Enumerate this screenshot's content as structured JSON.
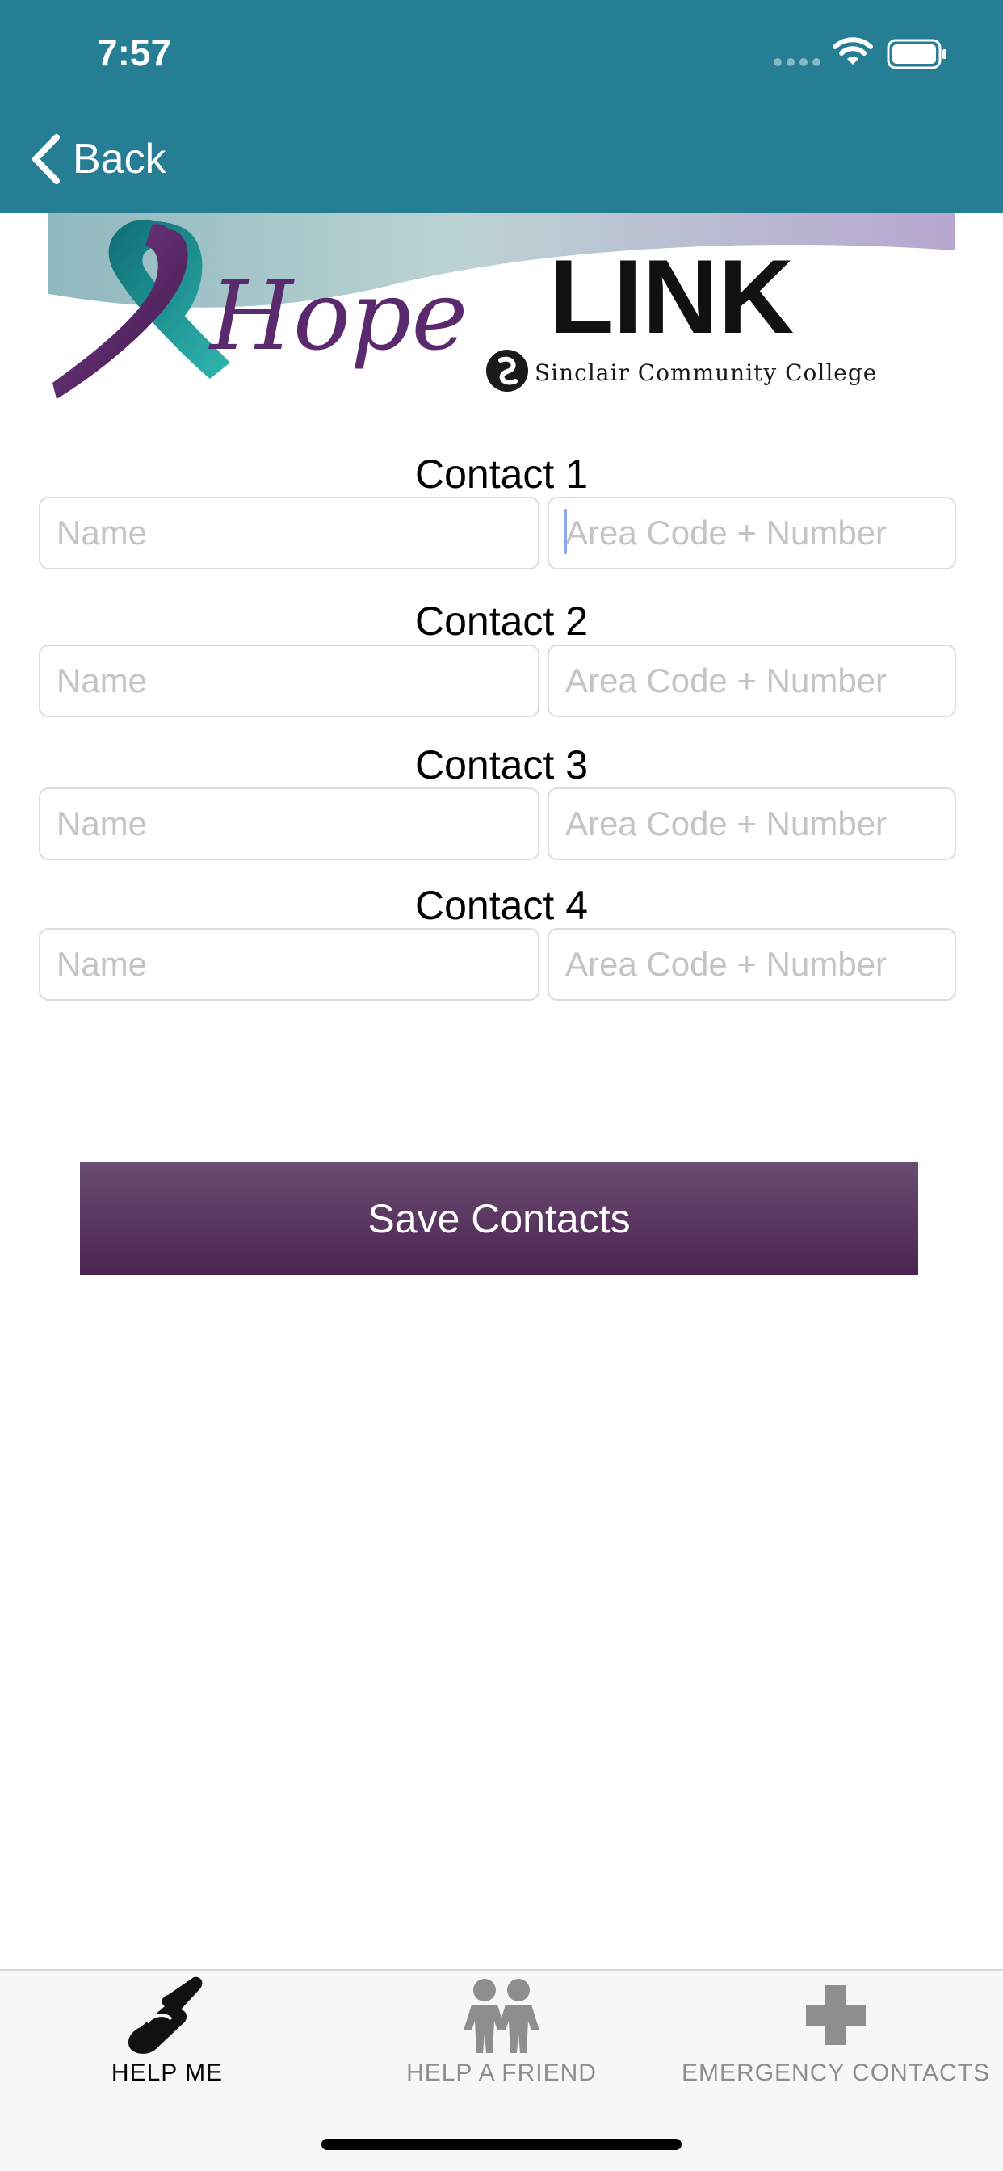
{
  "status_bar": {
    "time": "7:57"
  },
  "navigation": {
    "back_label": "Back"
  },
  "banner": {
    "logo_hope": "Hope",
    "logo_link": "LINK",
    "logo_college": "Sinclair Community College"
  },
  "contacts": [
    {
      "title": "Contact 1",
      "name_placeholder": "Name",
      "phone_placeholder": "Area Code + Number",
      "name_value": "",
      "phone_value": ""
    },
    {
      "title": "Contact 2",
      "name_placeholder": "Name",
      "phone_placeholder": "Area Code + Number",
      "name_value": "",
      "phone_value": ""
    },
    {
      "title": "Contact 3",
      "name_placeholder": "Name",
      "phone_placeholder": "Area Code + Number",
      "name_value": "",
      "phone_value": ""
    },
    {
      "title": "Contact 4",
      "name_placeholder": "Name",
      "phone_placeholder": "Area Code + Number",
      "name_value": "",
      "phone_value": ""
    }
  ],
  "save_button_label": "Save Contacts",
  "tabs": [
    {
      "label": "HELP ME",
      "icon": "helping-hands-icon",
      "active": true
    },
    {
      "label": "HELP A FRIEND",
      "icon": "two-people-icon",
      "active": false
    },
    {
      "label": "EMERGENCY CONTACTS",
      "icon": "medical-cross-icon",
      "active": false
    }
  ],
  "colors": {
    "nav_background": "#257e93",
    "button_purple": "#5a3463",
    "ribbon_purple": "#5b2a6e",
    "ribbon_teal": "#1e9a9c",
    "placeholder_gray": "#c4c4c6"
  }
}
